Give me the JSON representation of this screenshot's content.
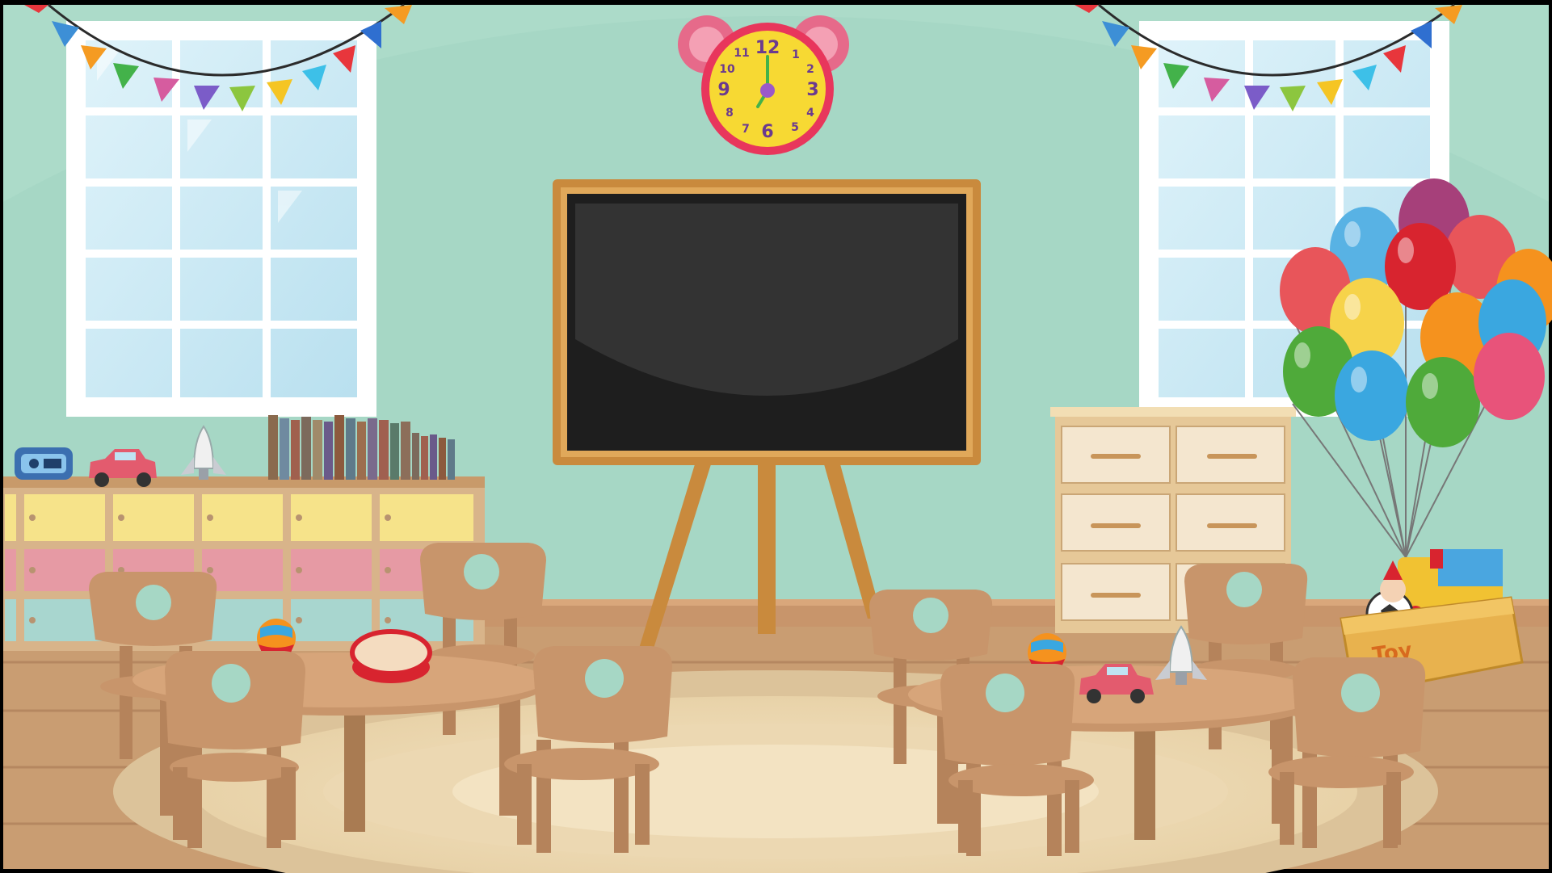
{
  "clock": {
    "numerals": [
      "12",
      "1",
      "2",
      "3",
      "4",
      "5",
      "6",
      "7",
      "8",
      "9",
      "10",
      "11"
    ]
  },
  "toy_box": {
    "label": "Toy"
  },
  "colors": {
    "wall": "#a6d7c5",
    "floor": "#c99d72",
    "chalkboard": "#2b2b2b",
    "wood": "#c8956b",
    "clock_face": "#f7d933",
    "clock_rim": "#e8365c"
  }
}
